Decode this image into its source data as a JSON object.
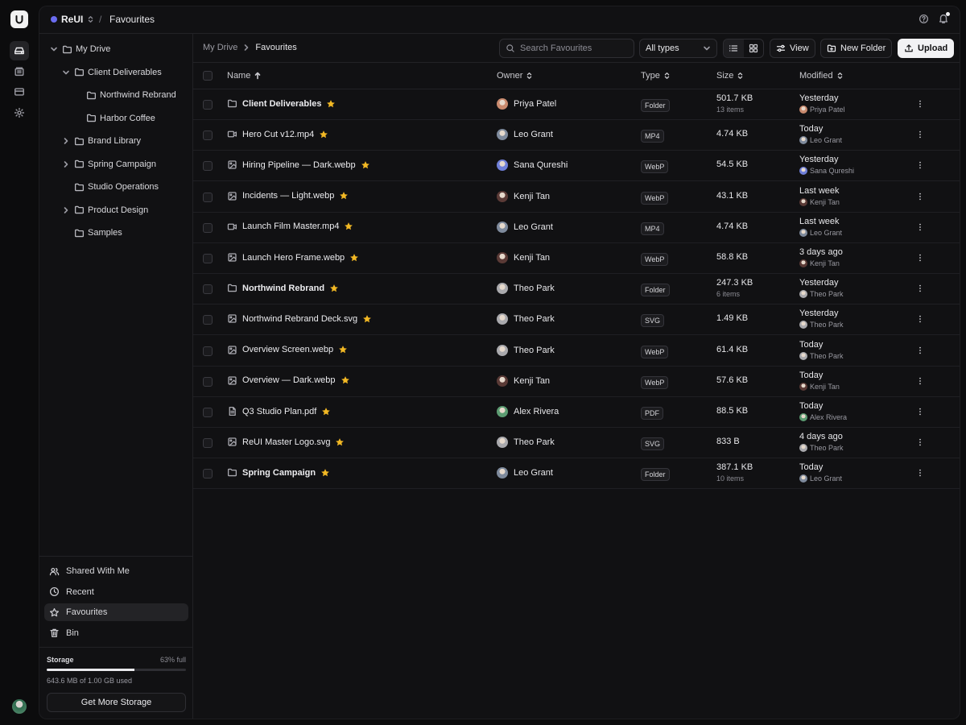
{
  "app": {
    "workspace": "ReUI",
    "page": "Favourites",
    "accent": "#6a6cf0",
    "star_color": "#f2b824"
  },
  "tree": [
    {
      "label": "My Drive",
      "depth": 0,
      "chevron": "down"
    },
    {
      "label": "Client Deliverables",
      "depth": 1,
      "chevron": "down"
    },
    {
      "label": "Northwind Rebrand",
      "depth": 2,
      "chevron": "none"
    },
    {
      "label": "Harbor Coffee",
      "depth": 2,
      "chevron": "none"
    },
    {
      "label": "Brand Library",
      "depth": 1,
      "chevron": "right"
    },
    {
      "label": "Spring Campaign",
      "depth": 1,
      "chevron": "right"
    },
    {
      "label": "Studio Operations",
      "depth": 1,
      "chevron": "none"
    },
    {
      "label": "Product Design",
      "depth": 1,
      "chevron": "right"
    },
    {
      "label": "Samples",
      "depth": 1,
      "chevron": "none"
    }
  ],
  "nav": [
    {
      "label": "Shared With Me",
      "icon": "users-icon",
      "active": false
    },
    {
      "label": "Recent",
      "icon": "clock-icon",
      "active": false
    },
    {
      "label": "Favourites",
      "icon": "star-icon",
      "active": true
    },
    {
      "label": "Bin",
      "icon": "trash-icon",
      "active": false
    }
  ],
  "storage": {
    "title": "Storage",
    "percent_label": "63% full",
    "fraction": 0.63,
    "used_text": "643.6 MB of 1.00 GB used",
    "button": "Get More Storage"
  },
  "breadcrumb": {
    "root": "My Drive",
    "current": "Favourites"
  },
  "toolbar": {
    "search_placeholder": "Search Favourites",
    "type_filter": "All types",
    "view_label": "View",
    "new_folder_label": "New Folder",
    "upload_label": "Upload"
  },
  "columns": {
    "name": "Name",
    "owner": "Owner",
    "type": "Type",
    "size": "Size",
    "modified": "Modified"
  },
  "rows": [
    {
      "name": "Client Deliverables",
      "kind": "folder",
      "owner": "Priya Patel",
      "type": "Folder",
      "size": "501.7 KB",
      "items": "13 items",
      "modified": "Yesterday",
      "modified_by": "Priya Patel"
    },
    {
      "name": "Hero Cut v12.mp4",
      "kind": "video",
      "owner": "Leo Grant",
      "type": "MP4",
      "size": "4.74 KB",
      "items": "",
      "modified": "Today",
      "modified_by": "Leo Grant"
    },
    {
      "name": "Hiring Pipeline — Dark.webp",
      "kind": "image",
      "owner": "Sana Qureshi",
      "type": "WebP",
      "size": "54.5 KB",
      "items": "",
      "modified": "Yesterday",
      "modified_by": "Sana Qureshi"
    },
    {
      "name": "Incidents — Light.webp",
      "kind": "image",
      "owner": "Kenji Tan",
      "type": "WebP",
      "size": "43.1 KB",
      "items": "",
      "modified": "Last week",
      "modified_by": "Kenji Tan"
    },
    {
      "name": "Launch Film Master.mp4",
      "kind": "video",
      "owner": "Leo Grant",
      "type": "MP4",
      "size": "4.74 KB",
      "items": "",
      "modified": "Last week",
      "modified_by": "Leo Grant"
    },
    {
      "name": "Launch Hero Frame.webp",
      "kind": "image",
      "owner": "Kenji Tan",
      "type": "WebP",
      "size": "58.8 KB",
      "items": "",
      "modified": "3 days ago",
      "modified_by": "Kenji Tan"
    },
    {
      "name": "Northwind Rebrand",
      "kind": "folder",
      "owner": "Theo Park",
      "type": "Folder",
      "size": "247.3 KB",
      "items": "6 items",
      "modified": "Yesterday",
      "modified_by": "Theo Park"
    },
    {
      "name": "Northwind Rebrand Deck.svg",
      "kind": "image",
      "owner": "Theo Park",
      "type": "SVG",
      "size": "1.49 KB",
      "items": "",
      "modified": "Yesterday",
      "modified_by": "Theo Park"
    },
    {
      "name": "Overview Screen.webp",
      "kind": "image",
      "owner": "Theo Park",
      "type": "WebP",
      "size": "61.4 KB",
      "items": "",
      "modified": "Today",
      "modified_by": "Theo Park"
    },
    {
      "name": "Overview — Dark.webp",
      "kind": "image",
      "owner": "Kenji Tan",
      "type": "WebP",
      "size": "57.6 KB",
      "items": "",
      "modified": "Today",
      "modified_by": "Kenji Tan"
    },
    {
      "name": "Q3 Studio Plan.pdf",
      "kind": "doc",
      "owner": "Alex Rivera",
      "type": "PDF",
      "size": "88.5 KB",
      "items": "",
      "modified": "Today",
      "modified_by": "Alex Rivera"
    },
    {
      "name": "ReUI Master Logo.svg",
      "kind": "image",
      "owner": "Theo Park",
      "type": "SVG",
      "size": "833 B",
      "items": "",
      "modified": "4 days ago",
      "modified_by": "Theo Park"
    },
    {
      "name": "Spring Campaign",
      "kind": "folder",
      "owner": "Leo Grant",
      "type": "Folder",
      "size": "387.1 KB",
      "items": "10 items",
      "modified": "Today",
      "modified_by": "Leo Grant"
    }
  ],
  "avatar_colors": {
    "Priya Patel": "#c98a6e",
    "Leo Grant": "#7e8a9c",
    "Sana Qureshi": "#6f7fd8",
    "Kenji Tan": "#5a3a36",
    "Theo Park": "#a9a9ad",
    "Alex Rivera": "#5c9c72"
  }
}
